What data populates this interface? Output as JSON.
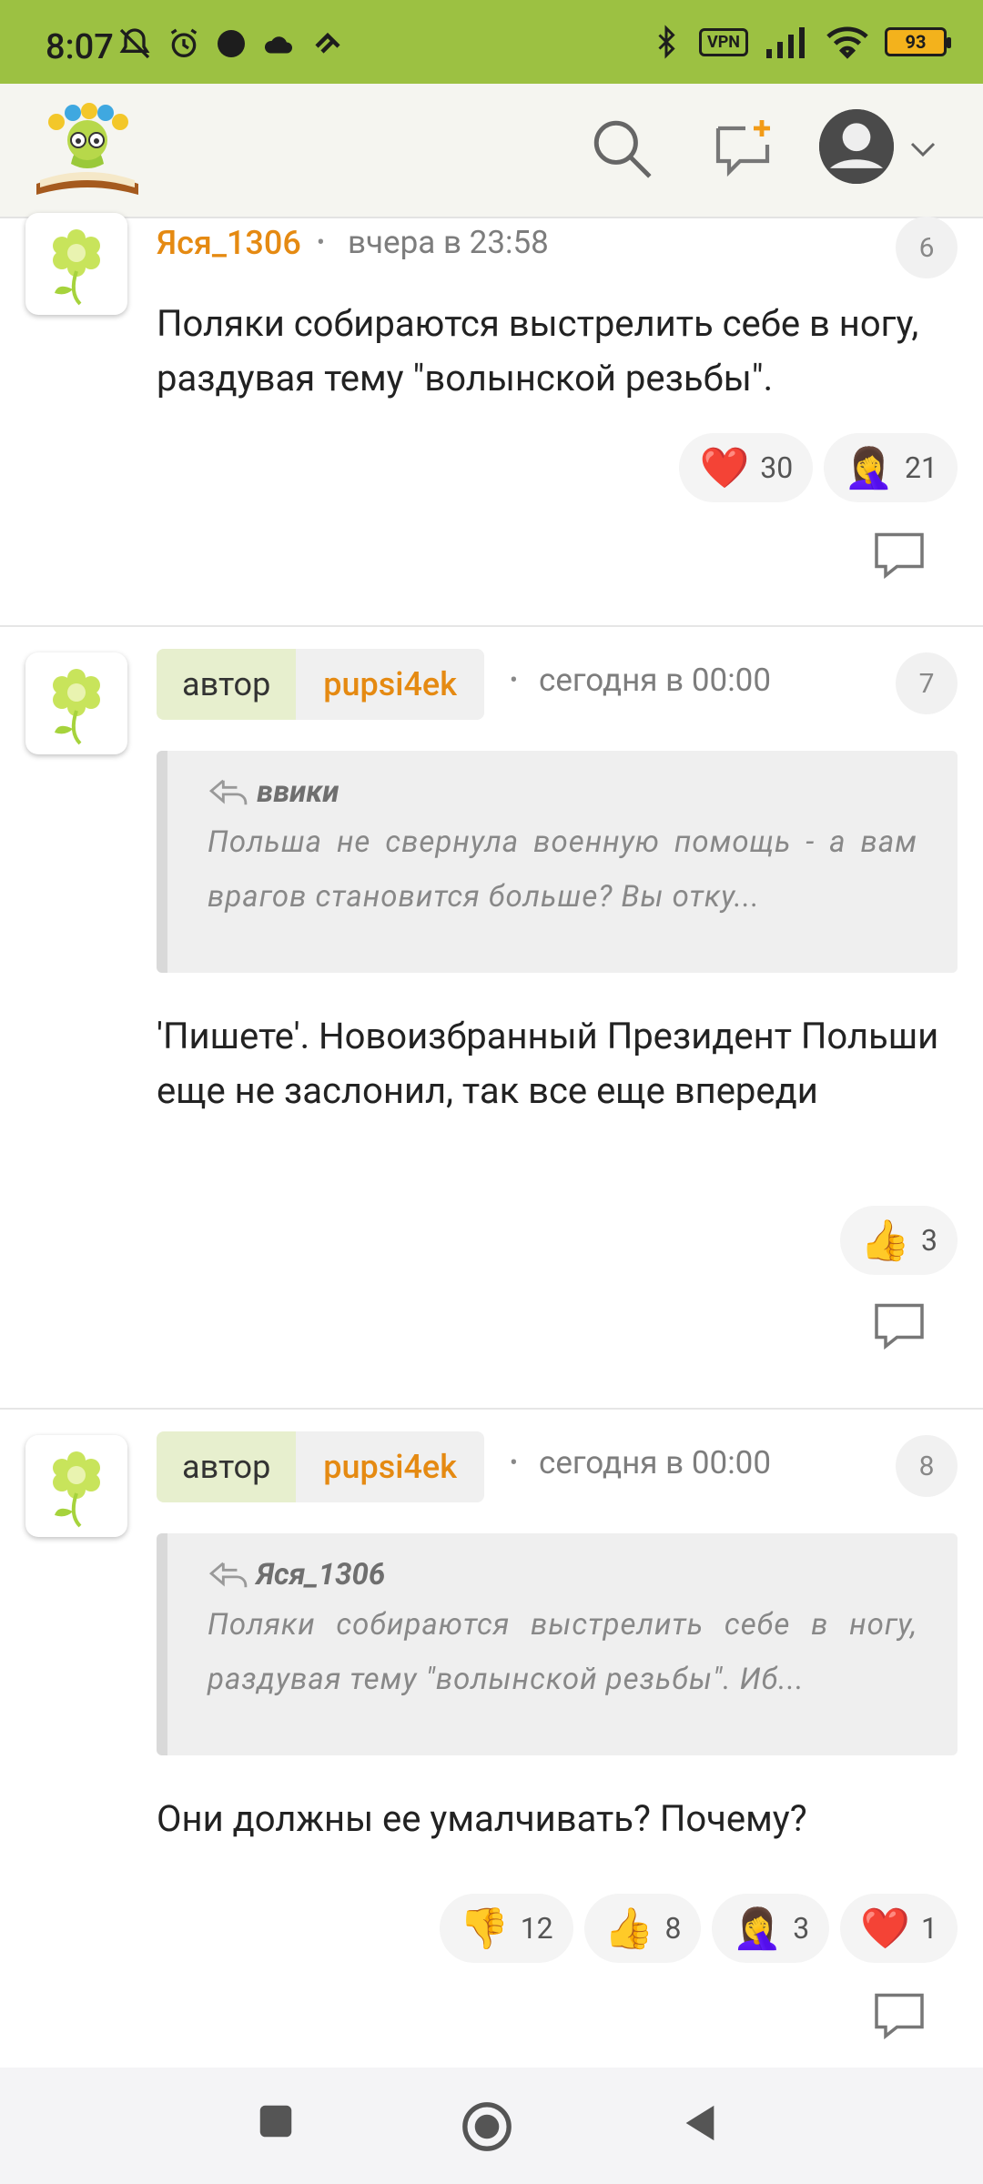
{
  "status": {
    "time": "8:07",
    "battery": "93",
    "vpn": "VPN"
  },
  "header": {
    "logo": "app-logo",
    "search_icon": "search-icon",
    "compose_icon": "new-post-icon",
    "account_icon": "account-icon"
  },
  "comments": [
    {
      "user": "Яся_1306",
      "time": "вчера в 23:58",
      "number": "6",
      "text": "Поляки собираются выстрелить себе в ногу, раздувая тему \"волынской резьбы\".",
      "reactions": [
        {
          "emoji": "❤️",
          "count": "30"
        },
        {
          "emoji": "🤦‍♀️",
          "count": "21"
        }
      ]
    },
    {
      "badge": "автор",
      "user": "pupsi4ek",
      "time": "сегодня в 00:00",
      "number": "7",
      "quote": {
        "name": "ввики",
        "text": "Польша не свернула военную помощь - а вам врагов становится больше? Вы отку..."
      },
      "text": "'Пишете'. Новоизбранный Президент Польши еще не заслонил, так все еще впереди",
      "reactions": [
        {
          "emoji": "👍",
          "count": "3"
        }
      ]
    },
    {
      "badge": "автор",
      "user": "pupsi4ek",
      "time": "сегодня в 00:00",
      "number": "8",
      "quote": {
        "name": "Яся_1306",
        "text": "Поляки собираются выстрелить себе в ногу, раздувая тему \"волынской резьбы\". Иб..."
      },
      "text": "Они должны ее умалчивать? Почему?",
      "reactions": [
        {
          "emoji": "👎",
          "count": "12"
        },
        {
          "emoji": "👍",
          "count": "8"
        },
        {
          "emoji": "🤦‍♀️",
          "count": "3"
        },
        {
          "emoji": "❤️",
          "count": "1"
        }
      ]
    }
  ],
  "bullet": "•",
  "colors": {
    "status_bar": "#9cc142",
    "username": "#e58a12",
    "author_badge": "#e7efce"
  }
}
